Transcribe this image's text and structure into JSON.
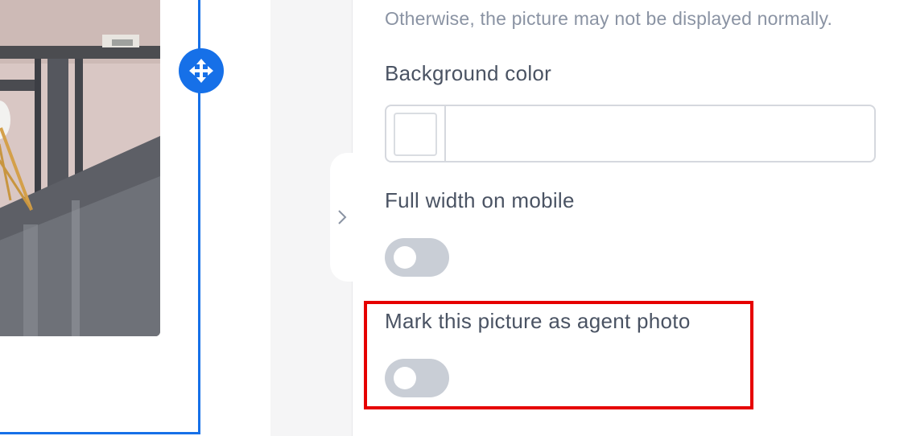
{
  "canvas": {
    "accent_color": "#1670e8",
    "move_handle_icon": "move-arrows-icon"
  },
  "sidebar_toggle": {
    "icon": "chevron-right-icon"
  },
  "settings": {
    "hint_text": "Otherwise, the picture may not be displayed normally.",
    "background_color": {
      "label": "Background color",
      "value": ""
    },
    "full_width_mobile": {
      "label": "Full width on mobile",
      "enabled": false
    },
    "agent_photo": {
      "label": "Mark this picture as agent photo",
      "enabled": false
    }
  },
  "highlight_color": "#e60000"
}
